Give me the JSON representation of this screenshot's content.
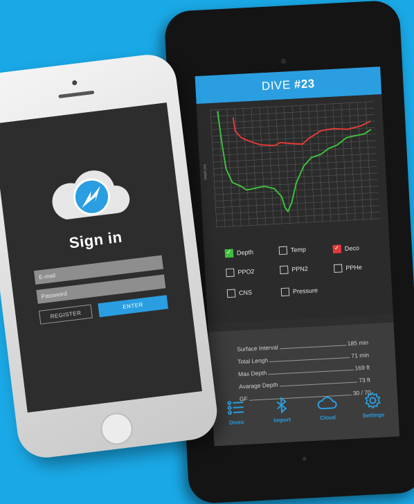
{
  "colors": {
    "background": "#1aa8e6",
    "accent": "#2a9ee0",
    "deco_line": "#e23a3a",
    "depth_line": "#3fbf3f"
  },
  "tablet": {
    "title_prefix": "DIVE ",
    "title_number": "#23",
    "chart": {
      "y_axis_label": "Depth (m)"
    },
    "checkboxes": [
      {
        "label": "Depth",
        "checked": true,
        "color": "green"
      },
      {
        "label": "Temp",
        "checked": false
      },
      {
        "label": "Deco",
        "checked": true,
        "color": "red"
      },
      {
        "label": "PPO2",
        "checked": false
      },
      {
        "label": "PPN2",
        "checked": false
      },
      {
        "label": "PPHe",
        "checked": false
      },
      {
        "label": "CNS",
        "checked": false
      },
      {
        "label": "Pressure",
        "checked": false
      }
    ],
    "stats": [
      {
        "label": "Surface Interval",
        "value": "185 min"
      },
      {
        "label": "Total Lengh",
        "value": "71 min"
      },
      {
        "label": "Max Depth",
        "value": "169 ft"
      },
      {
        "label": "Avarage Depth",
        "value": "73 ft"
      },
      {
        "label": "GF",
        "value": "30 / 70"
      }
    ],
    "nav": [
      {
        "label": "Dives",
        "icon": "list-icon"
      },
      {
        "label": "Import",
        "icon": "bluetooth-icon"
      },
      {
        "label": "Cloud",
        "icon": "cloud-icon"
      },
      {
        "label": "Settings",
        "icon": "gear-icon"
      }
    ]
  },
  "phone": {
    "title": "Sign in",
    "email_placeholder": "E-mail",
    "password_placeholder": "Password",
    "register_label": "REGISTER",
    "enter_label": "ENTER",
    "logo_icon": "shark-logo-icon"
  }
}
